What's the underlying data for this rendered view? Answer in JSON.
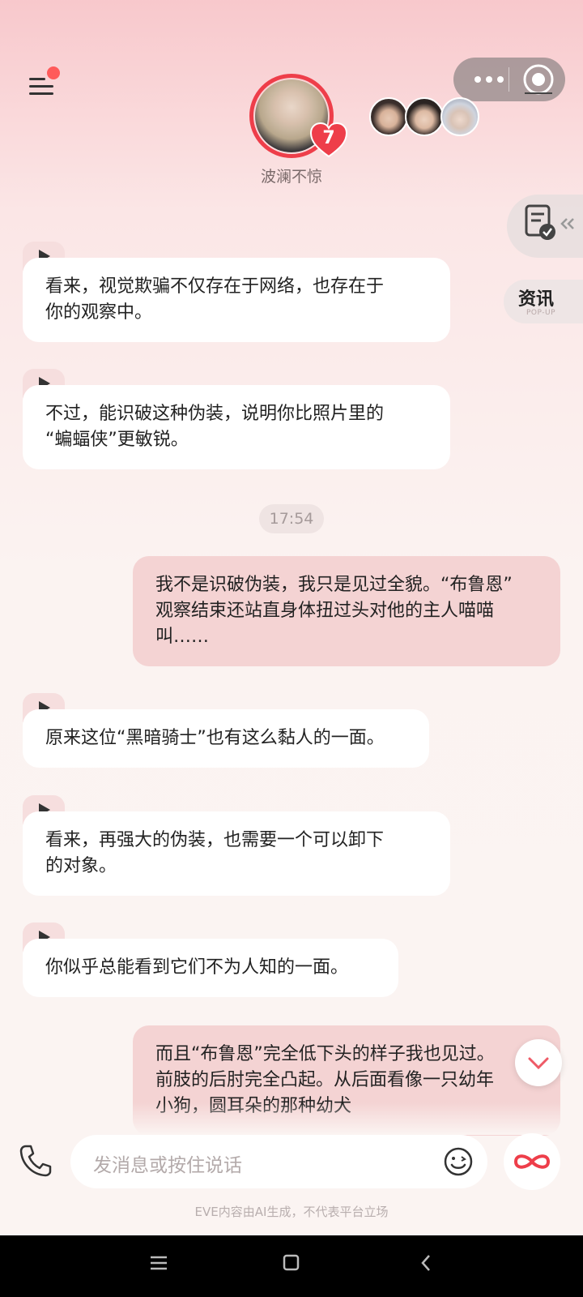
{
  "header": {
    "character_name": "波澜不惊",
    "affection_level": "7",
    "menu_icon": "menu-icon",
    "more_icon": "more-dots-icon",
    "target_icon": "target-icon"
  },
  "side_widgets": {
    "task_icon": "task-check-icon",
    "news_label": "资讯",
    "news_sub": "POP-UP"
  },
  "messages": [
    {
      "role": "ai",
      "text_lines": [
        "看来，视觉欺骗不仅存在于网络，也存在于",
        "你的观察中。"
      ]
    },
    {
      "role": "ai",
      "text_lines": [
        "不过，能识破这种伪装，说明你比照片里的",
        "“蝙蝠侠”更敏锐。"
      ]
    },
    {
      "role": "time",
      "text": "17:54"
    },
    {
      "role": "user",
      "text_lines": [
        "我不是识破伪装，我只是见过全貌。“布鲁恩”",
        "观察结束还站直身体扭过头对他的主人喵喵",
        "叫……"
      ]
    },
    {
      "role": "ai",
      "text_lines": [
        "原来这位“黑暗骑士”也有这么黏人的一面。"
      ]
    },
    {
      "role": "ai",
      "text_lines": [
        "看来，再强大的伪装，也需要一个可以卸下",
        "的对象。"
      ]
    },
    {
      "role": "ai",
      "text_lines": [
        "你似乎总能看到它们不为人知的一面。"
      ]
    },
    {
      "role": "user",
      "text_lines": [
        "而且“布鲁恩”完全低下头的样子我也见过。",
        "前肢的后肘完全凸起。从后面看像一只幼年",
        "小狗，圆耳朵的那种幼犬"
      ]
    }
  ],
  "input": {
    "placeholder": "发消息或按住说话",
    "phone_icon": "phone-icon",
    "emoji_icon": "emoji-icon",
    "infinity_icon": "infinity-icon"
  },
  "disclaimer": "EVE内容由AI生成，不代表平台立场",
  "colors": {
    "accent": "#ee3e4a",
    "user_bubble": "#f4d3d3",
    "ai_bubble": "#ffffff"
  }
}
